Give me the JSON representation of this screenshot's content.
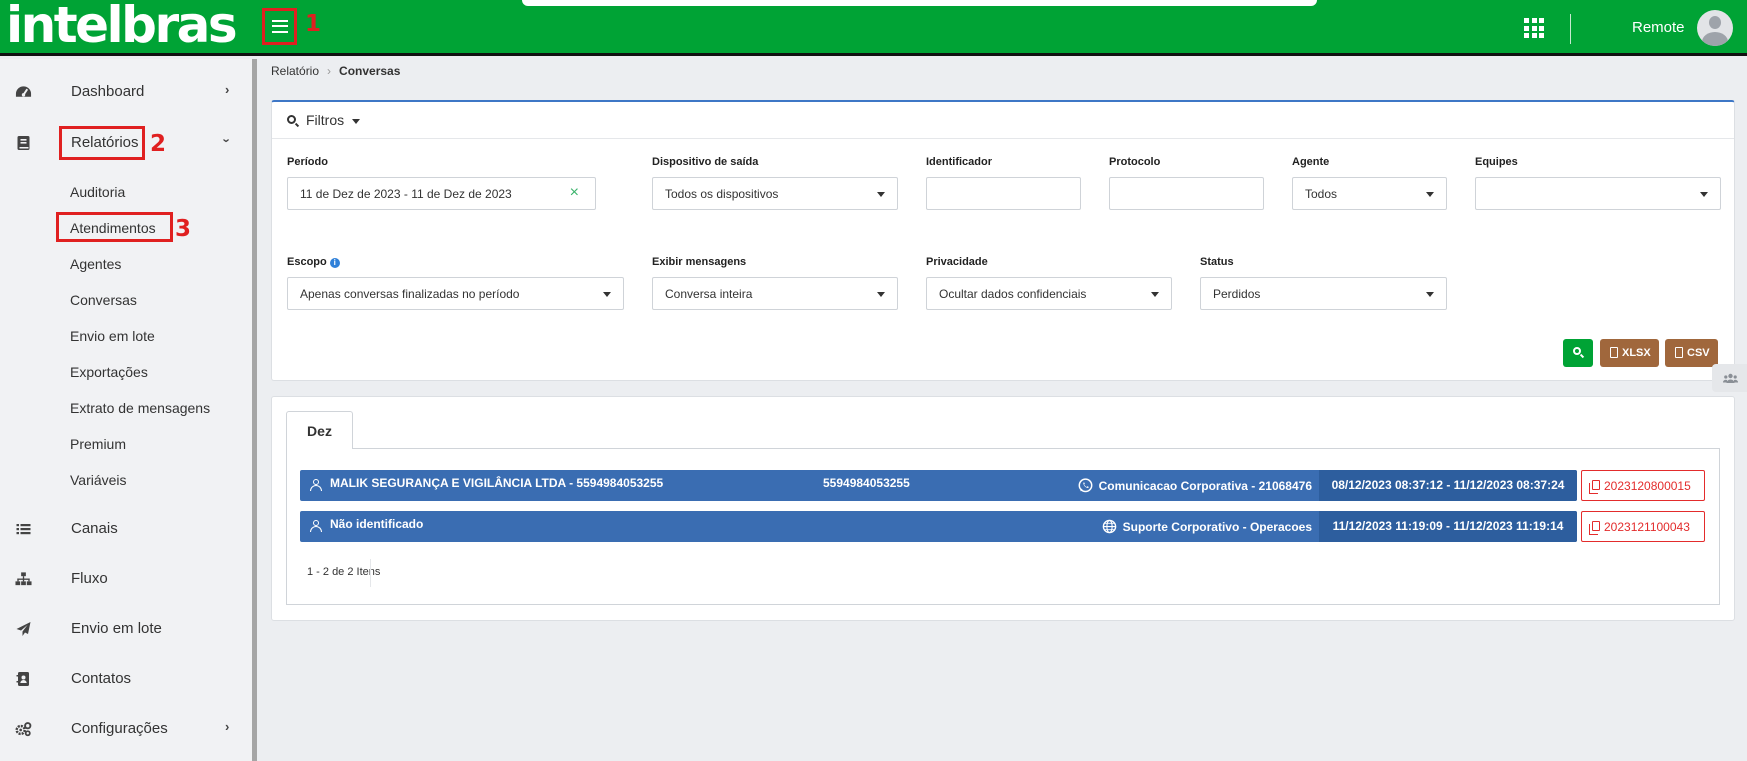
{
  "header": {
    "logo": "intelbras",
    "user_name": "Remote",
    "search_value": "",
    "icons": [
      "menu-icon",
      "apps-grid-icon",
      "avatar-icon"
    ]
  },
  "annotations": [
    "1",
    "2",
    "3"
  ],
  "sidebar": {
    "items": [
      {
        "label": "Dashboard",
        "icon": "dashboard-icon",
        "chevron": "›"
      },
      {
        "label": "Relatórios",
        "icon": "book-icon",
        "chevron": "›"
      },
      {
        "label": "Canais",
        "icon": "list-icon"
      },
      {
        "label": "Fluxo",
        "icon": "sitemap-icon"
      },
      {
        "label": "Envio em lote",
        "icon": "paper-plane-icon"
      },
      {
        "label": "Contatos",
        "icon": "address-book-icon"
      },
      {
        "label": "Configurações",
        "icon": "cogs-icon",
        "chevron": "›"
      }
    ],
    "report_subitems": [
      "Auditoria",
      "Atendimentos",
      "Agentes",
      "Conversas",
      "Envio em lote",
      "Exportações",
      "Extrato de mensagens",
      "Premium",
      "Variáveis"
    ]
  },
  "breadcrumb": {
    "parent": "Relatório",
    "separator": "›",
    "current": "Conversas"
  },
  "filters": {
    "title": "Filtros",
    "periodo": {
      "label": "Período",
      "value": "11 de Dez de 2023 - 11 de Dez de 2023",
      "clear": "×"
    },
    "dispositivo": {
      "label": "Dispositivo de saída",
      "value": "Todos os dispositivos"
    },
    "identificador": {
      "label": "Identificador",
      "value": ""
    },
    "protocolo": {
      "label": "Protocolo",
      "value": ""
    },
    "agente": {
      "label": "Agente",
      "value": "Todos"
    },
    "equipes": {
      "label": "Equipes",
      "value": ""
    },
    "escopo": {
      "label": "Escopo",
      "info": "i",
      "value": "Apenas conversas finalizadas no período"
    },
    "exibir": {
      "label": "Exibir mensagens",
      "value": "Conversa inteira"
    },
    "privacidade": {
      "label": "Privacidade",
      "value": "Ocultar dados confidenciais"
    },
    "status": {
      "label": "Status",
      "value": "Perdidos"
    },
    "buttons": {
      "xlsx": "XLSX",
      "csv": "CSV"
    }
  },
  "results": {
    "tab": "Dez",
    "rows": [
      {
        "name": "MALIK SEGURANÇA E VIGILÂNCIA LTDA - 5594984053255",
        "phone": "5594984053255",
        "channel_icon": "whatsapp-icon",
        "channel": "Comunicacao Corporativa - 21068476",
        "dates": "08/12/2023 08:37:12 - 11/12/2023 08:37:24",
        "protocol": "2023120800015"
      },
      {
        "name": "Não identificado",
        "phone": "",
        "channel_icon": "globe-icon",
        "channel": "Suporte Corporativo - Operacoes",
        "dates": "11/12/2023 11:19:09 - 11/12/2023 11:19:14",
        "protocol": "2023121100043"
      }
    ],
    "pagination": "1 - 2 de 2 Itens"
  },
  "colors": {
    "brand_green": "#00a335",
    "row_blue": "#3a6db2",
    "date_blue": "#2d5e9e",
    "export_brown": "#a0673c",
    "annotation_red": "#e02020",
    "protocol_red": "#e32c2c"
  }
}
